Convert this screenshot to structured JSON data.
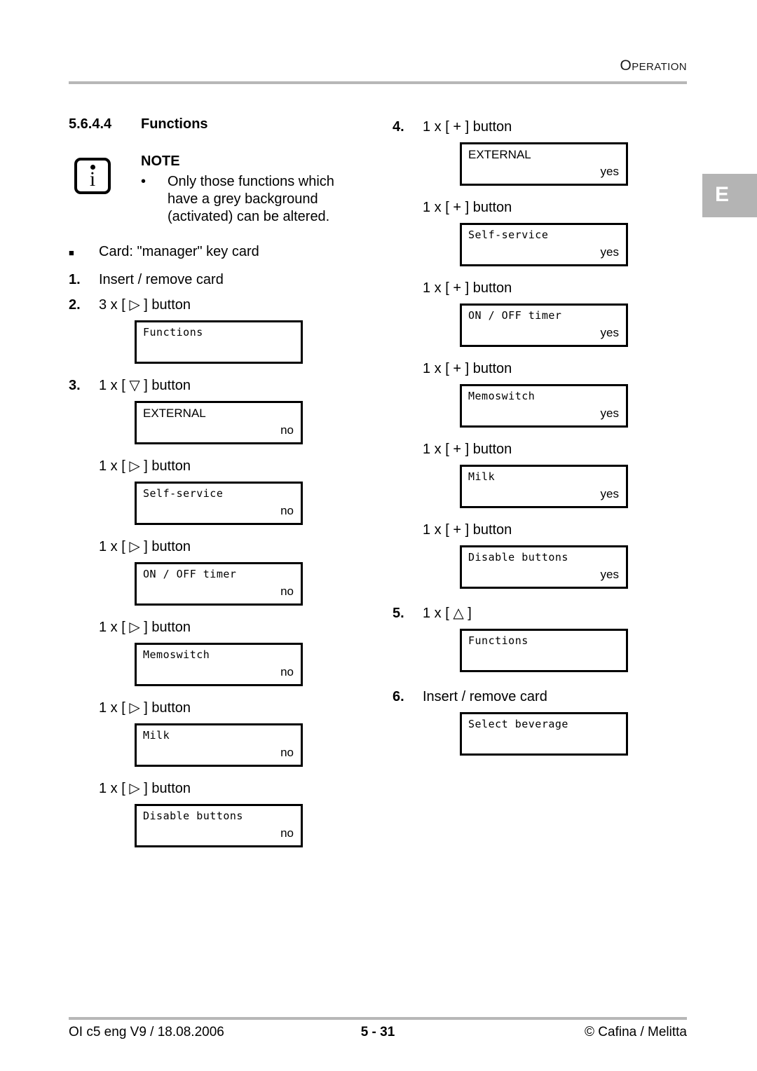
{
  "header": {
    "title": "Operation",
    "side_tab": "E"
  },
  "section": {
    "number": "5.6.4.4",
    "title": "Functions"
  },
  "note": {
    "icon": "info-icon",
    "title": "NOTE",
    "bullet": "•",
    "line1": "Only those functions which",
    "line2": "have a grey background",
    "line3": "(activated) can be altered."
  },
  "left_column": {
    "card_marker": "■",
    "card_text": "Card: \"manager\" key card",
    "steps": [
      {
        "marker": "1.",
        "text": "Insert / remove card"
      },
      {
        "marker": "2.",
        "text": "3 x [ ▷ ] button"
      },
      {
        "marker": "3.",
        "text": "1 x [ ▽ ] button"
      }
    ],
    "sub_step_right": "1 x [ ▷ ] button",
    "displays": [
      {
        "label": "Functions",
        "value": "",
        "mono": true
      },
      {
        "label": "EXTERNAL",
        "value": "no",
        "mono": false
      },
      {
        "label": "Self-service",
        "value": "no",
        "mono": true
      },
      {
        "label": "ON / OFF timer",
        "value": "no",
        "mono": true
      },
      {
        "label": "Memoswitch",
        "value": "no",
        "mono": true
      },
      {
        "label": "Milk",
        "value": "no",
        "mono": true
      },
      {
        "label": "Disable buttons",
        "value": "no",
        "mono": true
      }
    ]
  },
  "right_column": {
    "step4_marker": "4.",
    "step4_text": "1 x [ + ] button",
    "sub_step_plus": "1 x [ + ] button",
    "step5_marker": "5.",
    "step5_text": "1 x [ △ ]",
    "step6_marker": "6.",
    "step6_text": "Insert / remove card",
    "displays": [
      {
        "label": "EXTERNAL",
        "value": "yes",
        "mono": false
      },
      {
        "label": "Self-service",
        "value": "yes",
        "mono": true
      },
      {
        "label": "ON / OFF timer",
        "value": "yes",
        "mono": true
      },
      {
        "label": "Memoswitch",
        "value": "yes",
        "mono": true
      },
      {
        "label": "Milk",
        "value": "yes",
        "mono": true
      },
      {
        "label": "Disable buttons",
        "value": "yes",
        "mono": true
      },
      {
        "label": "Functions",
        "value": "",
        "mono": true
      },
      {
        "label": "Select beverage",
        "value": "",
        "mono": true
      }
    ]
  },
  "footer": {
    "left": "OI c5 eng V9 / 18.08.2006",
    "page": "5 - 31",
    "right": "© Cafina / Melitta"
  }
}
